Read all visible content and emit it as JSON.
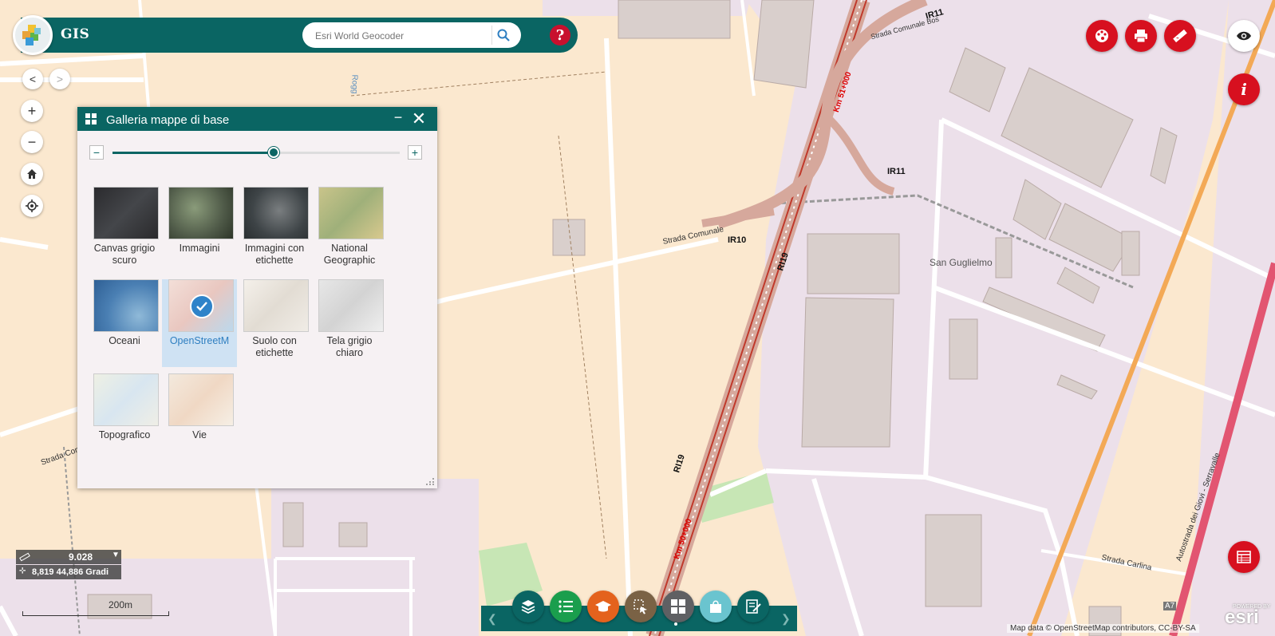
{
  "app": {
    "title": "GIS"
  },
  "search": {
    "placeholder": "Esri World Geocoder"
  },
  "help": {
    "label": "?"
  },
  "nav": {
    "back": "<",
    "forward": ">"
  },
  "zoom": {
    "in": "+",
    "out": "−"
  },
  "gallery": {
    "title": "Galleria mappe di base",
    "minimize": "−",
    "close": "✕",
    "slider": {
      "minus": "−",
      "plus": "+",
      "value_fraction": 0.56
    },
    "items": [
      {
        "label": "Canvas grigio scuro",
        "icon": "dark-gray-canvas-thumbnail",
        "selected": false
      },
      {
        "label": "Immagini",
        "icon": "imagery-thumbnail",
        "selected": false
      },
      {
        "label": "Immagini con etichette",
        "icon": "imagery-labels-thumbnail",
        "selected": false
      },
      {
        "label": "National Geographic",
        "icon": "national-geographic-thumbnail",
        "selected": false
      },
      {
        "label": "Oceani",
        "icon": "oceans-thumbnail",
        "selected": false
      },
      {
        "label": "OpenStreetM",
        "icon": "openstreetmap-thumbnail",
        "selected": true
      },
      {
        "label": "Suolo con etichette",
        "icon": "terrain-labels-thumbnail",
        "selected": false
      },
      {
        "label": "Tela grigio chiaro",
        "icon": "light-gray-canvas-thumbnail",
        "selected": false
      },
      {
        "label": "Topografico",
        "icon": "topographic-thumbnail",
        "selected": false
      },
      {
        "label": "Vie",
        "icon": "streets-thumbnail",
        "selected": false
      }
    ]
  },
  "scale": {
    "value": "9.028",
    "coords": "8,819 44,886 Gradi",
    "scalebar": "200m"
  },
  "map_labels": {
    "strada_comunale": "Strada Comunale",
    "strada_comu_left": "Strada Comu",
    "strada_comunale_top": "Strada Comunale Bos",
    "ir10": "IR10",
    "ir11_a": "IR11",
    "ir11_b": "IR11",
    "ri19_a": "RI19",
    "ri19_b": "RI19",
    "km51": "Km 51+000",
    "km50": "Km 50+000",
    "san_guglielmo": "San Guglielmo",
    "strada_carlina": "Strada Carlina",
    "autostrada": "Autostrada dei Giovi - Serravalle",
    "a7": "A7",
    "roggia": "Rogg"
  },
  "attribution": "Map data © OpenStreetMap contributors, CC-BY-SA",
  "esri": {
    "powered": "POWERED BY",
    "name": "esri"
  },
  "colors": {
    "primary": "#0a6563",
    "danger": "#d7101f",
    "selected": "#2f83c9"
  }
}
